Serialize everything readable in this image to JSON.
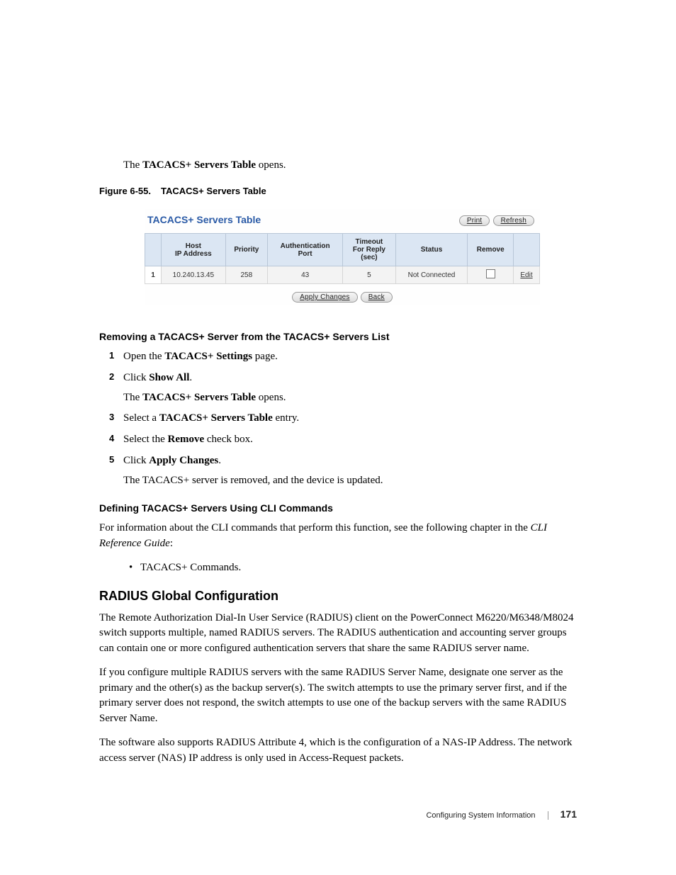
{
  "intro": {
    "prefix": "The ",
    "bold": "TACACS+ Servers Table",
    "suffix": " opens."
  },
  "figure": {
    "label": "Figure 6-55.",
    "title": "TACACS+ Servers Table"
  },
  "screenshot": {
    "title": "TACACS+ Servers Table",
    "buttons": {
      "print": "Print",
      "refresh": "Refresh",
      "apply": "Apply Changes",
      "back": "Back"
    },
    "headers": {
      "idx": "",
      "host": "Host\nIP Address",
      "priority": "Priority",
      "authport": "Authentication\nPort",
      "timeout": "Timeout\nFor Reply\n(sec)",
      "status": "Status",
      "remove": "Remove",
      "edit": ""
    },
    "rows": [
      {
        "idx": "1",
        "host": "10.240.13.45",
        "priority": "258",
        "authport": "43",
        "timeout": "5",
        "status": "Not Connected",
        "edit": "Edit"
      }
    ]
  },
  "removing": {
    "heading": "Removing a TACACS+ Server from the TACACS+ Servers List",
    "steps": [
      {
        "parts": [
          "Open the ",
          {
            "b": "TACACS+ Settings"
          },
          " page."
        ]
      },
      {
        "parts": [
          "Click ",
          {
            "b": "Show All"
          },
          "."
        ],
        "after": {
          "parts": [
            "The ",
            {
              "b": "TACACS+ Servers Table"
            },
            " opens."
          ]
        }
      },
      {
        "parts": [
          "Select a ",
          {
            "b": "TACACS+ Servers Table"
          },
          " entry."
        ]
      },
      {
        "parts": [
          "Select the ",
          {
            "b": "Remove"
          },
          " check box."
        ]
      },
      {
        "parts": [
          "Click ",
          {
            "b": "Apply Changes"
          },
          "."
        ],
        "after": {
          "parts": [
            "The TACACS+ server is removed, and the device is updated."
          ]
        }
      }
    ]
  },
  "cli": {
    "heading": "Defining TACACS+ Servers Using CLI Commands",
    "intro_parts": [
      "For information about the CLI commands that perform this function, see the following chapter in the ",
      {
        "i": "CLI Reference Guide"
      },
      ":"
    ],
    "bullet": "TACACS+ Commands."
  },
  "radius": {
    "heading": "RADIUS Global Configuration",
    "p1": "The Remote Authorization Dial-In User Service (RADIUS) client on the PowerConnect M6220/M6348/M8024 switch supports multiple, named RADIUS servers. The RADIUS authentication and accounting server groups can contain one or more configured authentication servers that share the same RADIUS server name.",
    "p2": "If you configure multiple RADIUS servers with the same RADIUS Server Name, designate one server as the primary and the other(s) as the backup server(s). The switch attempts to use the primary server first, and if the primary server does not respond, the switch attempts to use one of the backup servers with the same RADIUS Server Name.",
    "p3": "The software also supports RADIUS Attribute 4, which is the configuration of a NAS-IP Address. The network access server (NAS) IP address is only used in Access-Request packets."
  },
  "footer": {
    "section": "Configuring System Information",
    "page": "171"
  }
}
